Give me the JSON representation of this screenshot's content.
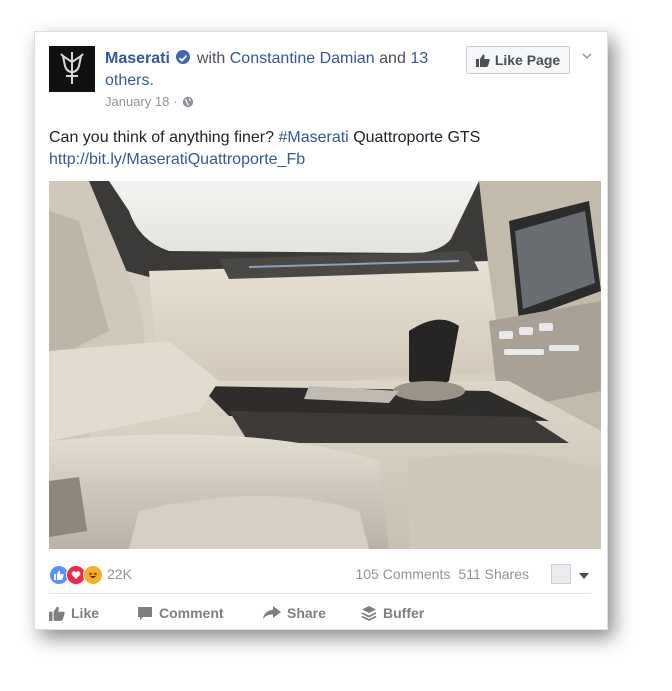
{
  "post": {
    "page_name": "Maserati",
    "with_text": "with",
    "tagged": "Constantine Damian",
    "and_text": "and",
    "others": "13 others.",
    "date": "January 18",
    "sep": "·",
    "like_page_label": "Like Page",
    "text_before": "Can you think of anything finer?",
    "hashtag": "#Maserati",
    "text_after": "Quattroporte GTS",
    "link": "http://bit.ly/MaseratiQuattroporte_Fb"
  },
  "stats": {
    "reaction_count": "22K",
    "comments": "105 Comments",
    "shares": "511 Shares"
  },
  "actions": {
    "like": "Like",
    "comment": "Comment",
    "share": "Share",
    "buffer": "Buffer"
  },
  "colors": {
    "link": "#365899",
    "like_blue": "#5890ff",
    "love_red": "#f0284a",
    "haha_yellow": "#f7b125"
  },
  "icons": [
    "maserati-trident-logo",
    "verified-badge-icon",
    "globe-icon",
    "thumbs-up-icon",
    "chevron-down-icon",
    "comment-icon",
    "share-arrow-icon",
    "buffer-stack-icon"
  ]
}
